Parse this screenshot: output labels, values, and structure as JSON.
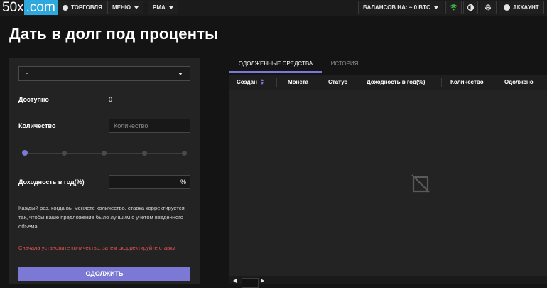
{
  "header": {
    "logo_num": "50x",
    "logo_domain": ".com",
    "trade_label": "ТОРГОВЛЯ",
    "menu_label": "МЕНЮ",
    "rma_label": "PMA",
    "balance_label": "БАЛАНСОВ НА: ~ 0 BTC",
    "account_label": "АККАУНТ"
  },
  "page_title": "Дать в долг под проценты",
  "form": {
    "currency_selected": "-",
    "available_label": "Доступно",
    "available_value": "0",
    "amount_label": "Количество",
    "amount_placeholder": "Количество",
    "slider_value_percent": 0,
    "rate_label": "Доходность в год(%)",
    "rate_unit": "%",
    "info_text": "Каждый раз, когда вы меняете количество, ставка корректируется так, чтобы ваше предложение было лучшим с учетом введенного объема.",
    "warning_text": "Сначала установите количество, затем скорректируйте ставку.",
    "submit_label": "ОДОЛЖИТЬ"
  },
  "tabs": [
    {
      "label": "ОДОЛЖЕННЫЕ СРЕДСТВА",
      "active": true
    },
    {
      "label": "ИСТОРИЯ",
      "active": false
    }
  ],
  "table": {
    "columns": [
      "Создан",
      "Монета",
      "Статус",
      "Доходность в год(%)",
      "Количество",
      "Одолжено"
    ],
    "rows": []
  },
  "colors": {
    "accent": "#7b78d6",
    "warning": "#e4544e",
    "logo_blue": "#2ea8dd",
    "wifi_green": "#3fbf3f"
  },
  "icons": [
    "globe-icon",
    "chevron-down-icon",
    "wifi-icon",
    "contrast-icon",
    "gear-icon",
    "user-icon",
    "sort-icon",
    "no-data-icon",
    "arrow-left-icon",
    "arrow-right-icon"
  ]
}
